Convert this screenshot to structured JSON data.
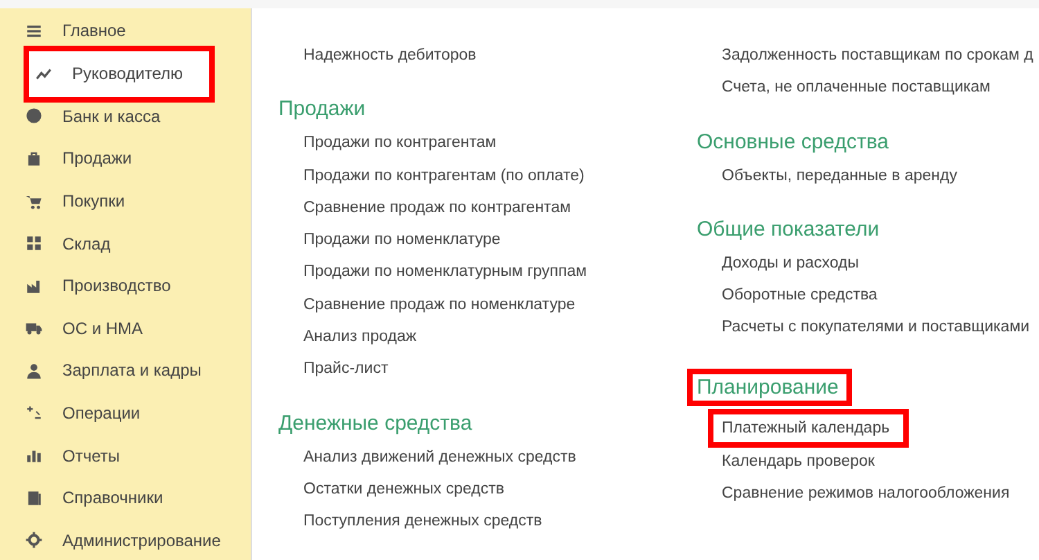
{
  "sidebar": {
    "items": [
      {
        "label": "Главное",
        "selected": false,
        "highlighted": false
      },
      {
        "label": "Руководителю",
        "selected": true,
        "highlighted": true
      },
      {
        "label": "Банк и касса",
        "selected": false,
        "highlighted": false
      },
      {
        "label": "Продажи",
        "selected": false,
        "highlighted": false
      },
      {
        "label": "Покупки",
        "selected": false,
        "highlighted": false
      },
      {
        "label": "Склад",
        "selected": false,
        "highlighted": false
      },
      {
        "label": "Производство",
        "selected": false,
        "highlighted": false
      },
      {
        "label": "ОС и НМА",
        "selected": false,
        "highlighted": false
      },
      {
        "label": "Зарплата и кадры",
        "selected": false,
        "highlighted": false
      },
      {
        "label": "Операции",
        "selected": false,
        "highlighted": false
      },
      {
        "label": "Отчеты",
        "selected": false,
        "highlighted": false
      },
      {
        "label": "Справочники",
        "selected": false,
        "highlighted": false
      },
      {
        "label": "Администрирование",
        "selected": false,
        "highlighted": false
      }
    ]
  },
  "columns": [
    {
      "sections": [
        {
          "links": [
            {
              "label": "Надежность дебиторов",
              "highlighted": false
            }
          ]
        },
        {
          "heading": "Продажи",
          "highlighted": false,
          "links": [
            {
              "label": "Продажи по контрагентам",
              "highlighted": false
            },
            {
              "label": "Продажи по контрагентам (по оплате)",
              "highlighted": false
            },
            {
              "label": "Сравнение продаж по контрагентам",
              "highlighted": false
            },
            {
              "label": "Продажи по номенклатуре",
              "highlighted": false
            },
            {
              "label": "Продажи по номенклатурным группам",
              "highlighted": false
            },
            {
              "label": "Сравнение продаж по номенклатуре",
              "highlighted": false
            },
            {
              "label": "Анализ продаж",
              "highlighted": false
            },
            {
              "label": "Прайс-лист",
              "highlighted": false
            }
          ]
        },
        {
          "heading": "Денежные средства",
          "highlighted": false,
          "links": [
            {
              "label": "Анализ движений денежных средств",
              "highlighted": false
            },
            {
              "label": "Остатки денежных средств",
              "highlighted": false
            },
            {
              "label": "Поступления денежных средств",
              "highlighted": false
            }
          ]
        }
      ]
    },
    {
      "sections": [
        {
          "links": [
            {
              "label": "Задолженность поставщикам по срокам д",
              "highlighted": false
            },
            {
              "label": "Счета, не оплаченные поставщикам",
              "highlighted": false
            }
          ]
        },
        {
          "heading": "Основные средства",
          "highlighted": false,
          "links": [
            {
              "label": "Объекты, переданные в аренду",
              "highlighted": false
            }
          ]
        },
        {
          "heading": "Общие показатели",
          "highlighted": false,
          "links": [
            {
              "label": "Доходы и расходы",
              "highlighted": false
            },
            {
              "label": "Оборотные средства",
              "highlighted": false
            },
            {
              "label": "Расчеты с покупателями и поставщиками",
              "highlighted": false
            }
          ]
        },
        {
          "heading": "Планирование",
          "highlighted": true,
          "links": [
            {
              "label": "Платежный календарь",
              "highlighted": true
            },
            {
              "label": "Календарь проверок",
              "highlighted": false
            },
            {
              "label": "Сравнение режимов налогообложения",
              "highlighted": false
            }
          ]
        }
      ]
    }
  ]
}
